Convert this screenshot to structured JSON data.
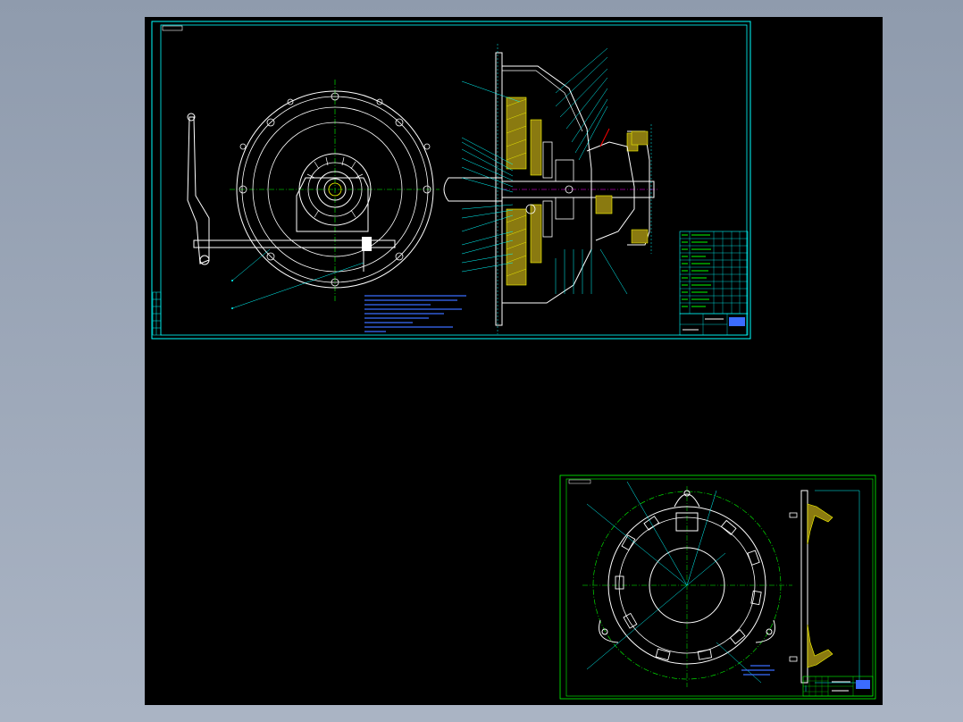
{
  "viewer": {
    "background_color": "#000000",
    "frame_color": "#00ffff",
    "accent_colors": [
      "#00ff00",
      "#ffff00",
      "#ff00ff",
      "#0000ff",
      "#ffffff",
      "#ff0000"
    ]
  },
  "sheet_main": {
    "tag_label": "",
    "notes_title": "",
    "notes": [
      "",
      "",
      "",
      "",
      "",
      "",
      "",
      "",
      ""
    ]
  },
  "sheet_detail": {
    "tag_label": "",
    "notes": [
      "",
      "",
      ""
    ]
  }
}
